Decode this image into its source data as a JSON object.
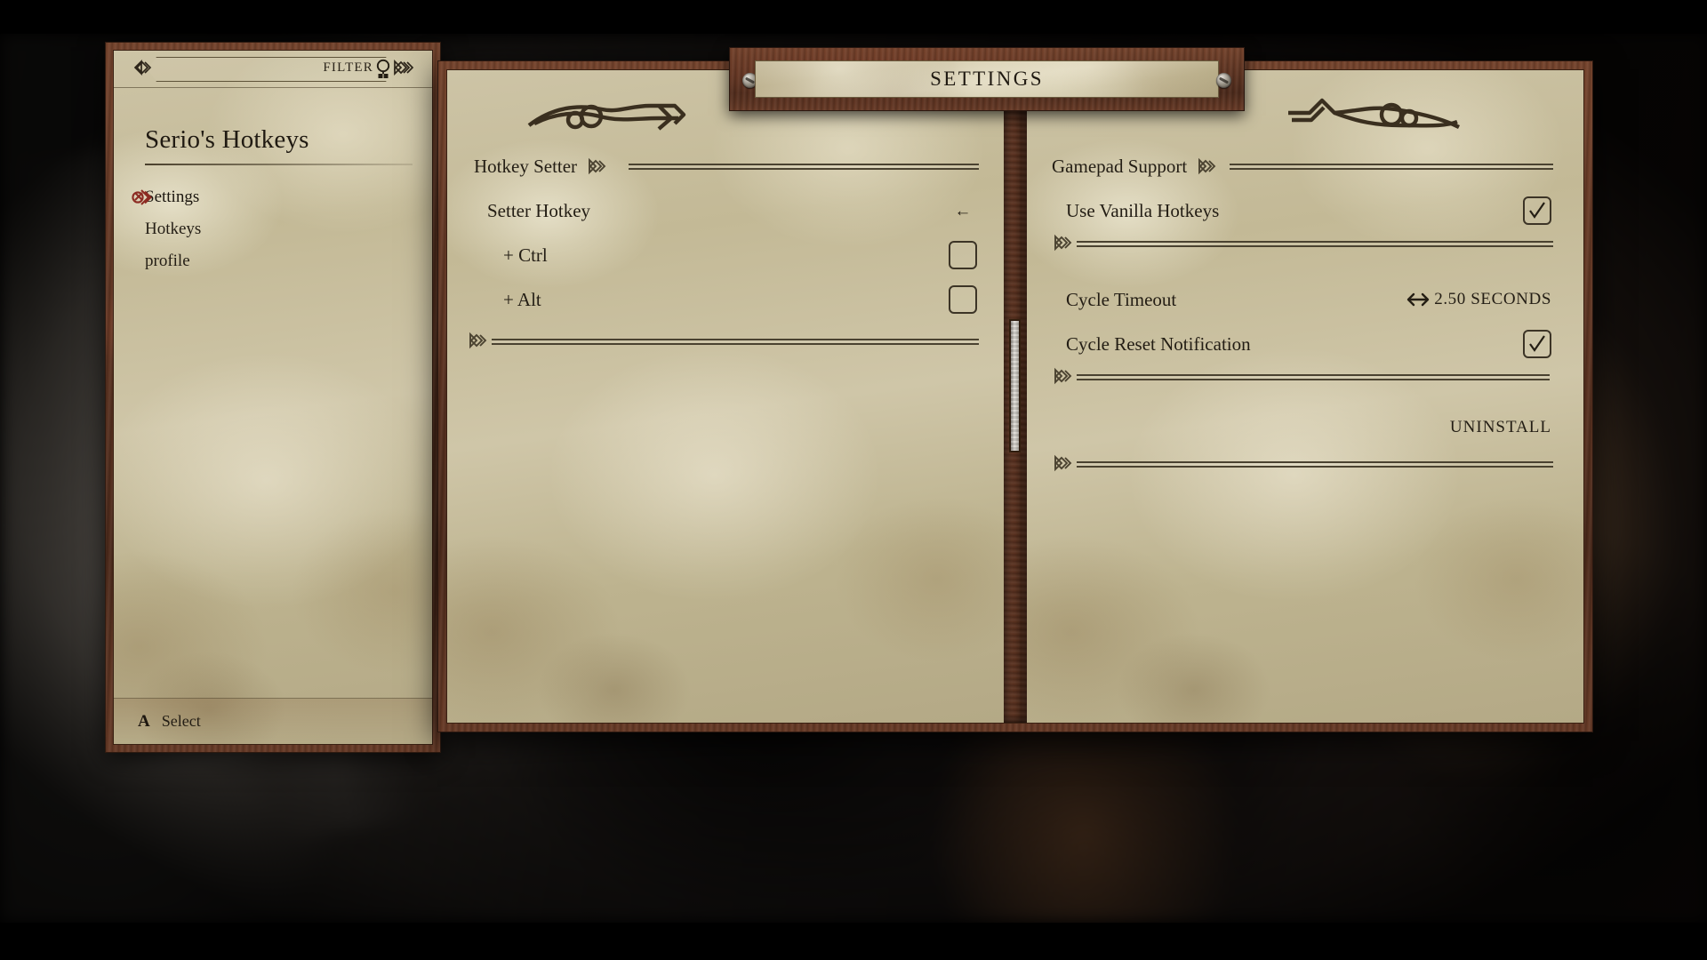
{
  "window": {
    "title": "SETTINGS"
  },
  "sidebar": {
    "filter": {
      "label": "FILTER",
      "placeholder": "",
      "value": "",
      "icon": "filter-magnifier-icon",
      "left_ornament": "knot-ornament-icon",
      "right_ornament": "knot-ornament-icon"
    },
    "title": "Serio's Hotkeys",
    "items": [
      {
        "label": "Settings",
        "selected": true,
        "marker_icon": "knot-marker-icon"
      },
      {
        "label": "Hotkeys",
        "selected": false,
        "marker_icon": ""
      },
      {
        "label": "profile",
        "selected": false,
        "marker_icon": ""
      }
    ],
    "footer": {
      "button_glyph": "A",
      "button_label": "Select"
    }
  },
  "left_page": {
    "header": {
      "label": "Hotkey Setter",
      "knot_icon": "knot-ornament-icon"
    },
    "rows": [
      {
        "label": "Setter Hotkey",
        "value": "←",
        "value_kind": "arrow",
        "control": "arrow-left-icon"
      },
      {
        "label": "+ Ctrl",
        "value": "",
        "value_kind": "checkbox",
        "checked": false
      },
      {
        "label": "+ Alt",
        "value": "",
        "value_kind": "checkbox",
        "checked": false
      }
    ],
    "separator_after_rows": true
  },
  "right_page": {
    "header": {
      "label": "Gamepad Support",
      "knot_icon": "knot-ornament-icon"
    },
    "rows": [
      {
        "label": "Use Vanilla Hotkeys",
        "value": "",
        "value_kind": "checkbox",
        "checked": true
      },
      {
        "label": "Cycle Timeout",
        "value": "2.50 SECONDS",
        "value_kind": "slider",
        "slider_glyph": "<->"
      },
      {
        "label": "Cycle Reset Notification",
        "value": "",
        "value_kind": "checkbox",
        "checked": true
      }
    ],
    "uninstall_button": "UNINSTALL"
  },
  "colors": {
    "paper": "#c8bfa2",
    "wood": "#5e3523",
    "ink": "#231d14",
    "accent_selected": "#8c2b22",
    "rule": "#4a4230"
  }
}
